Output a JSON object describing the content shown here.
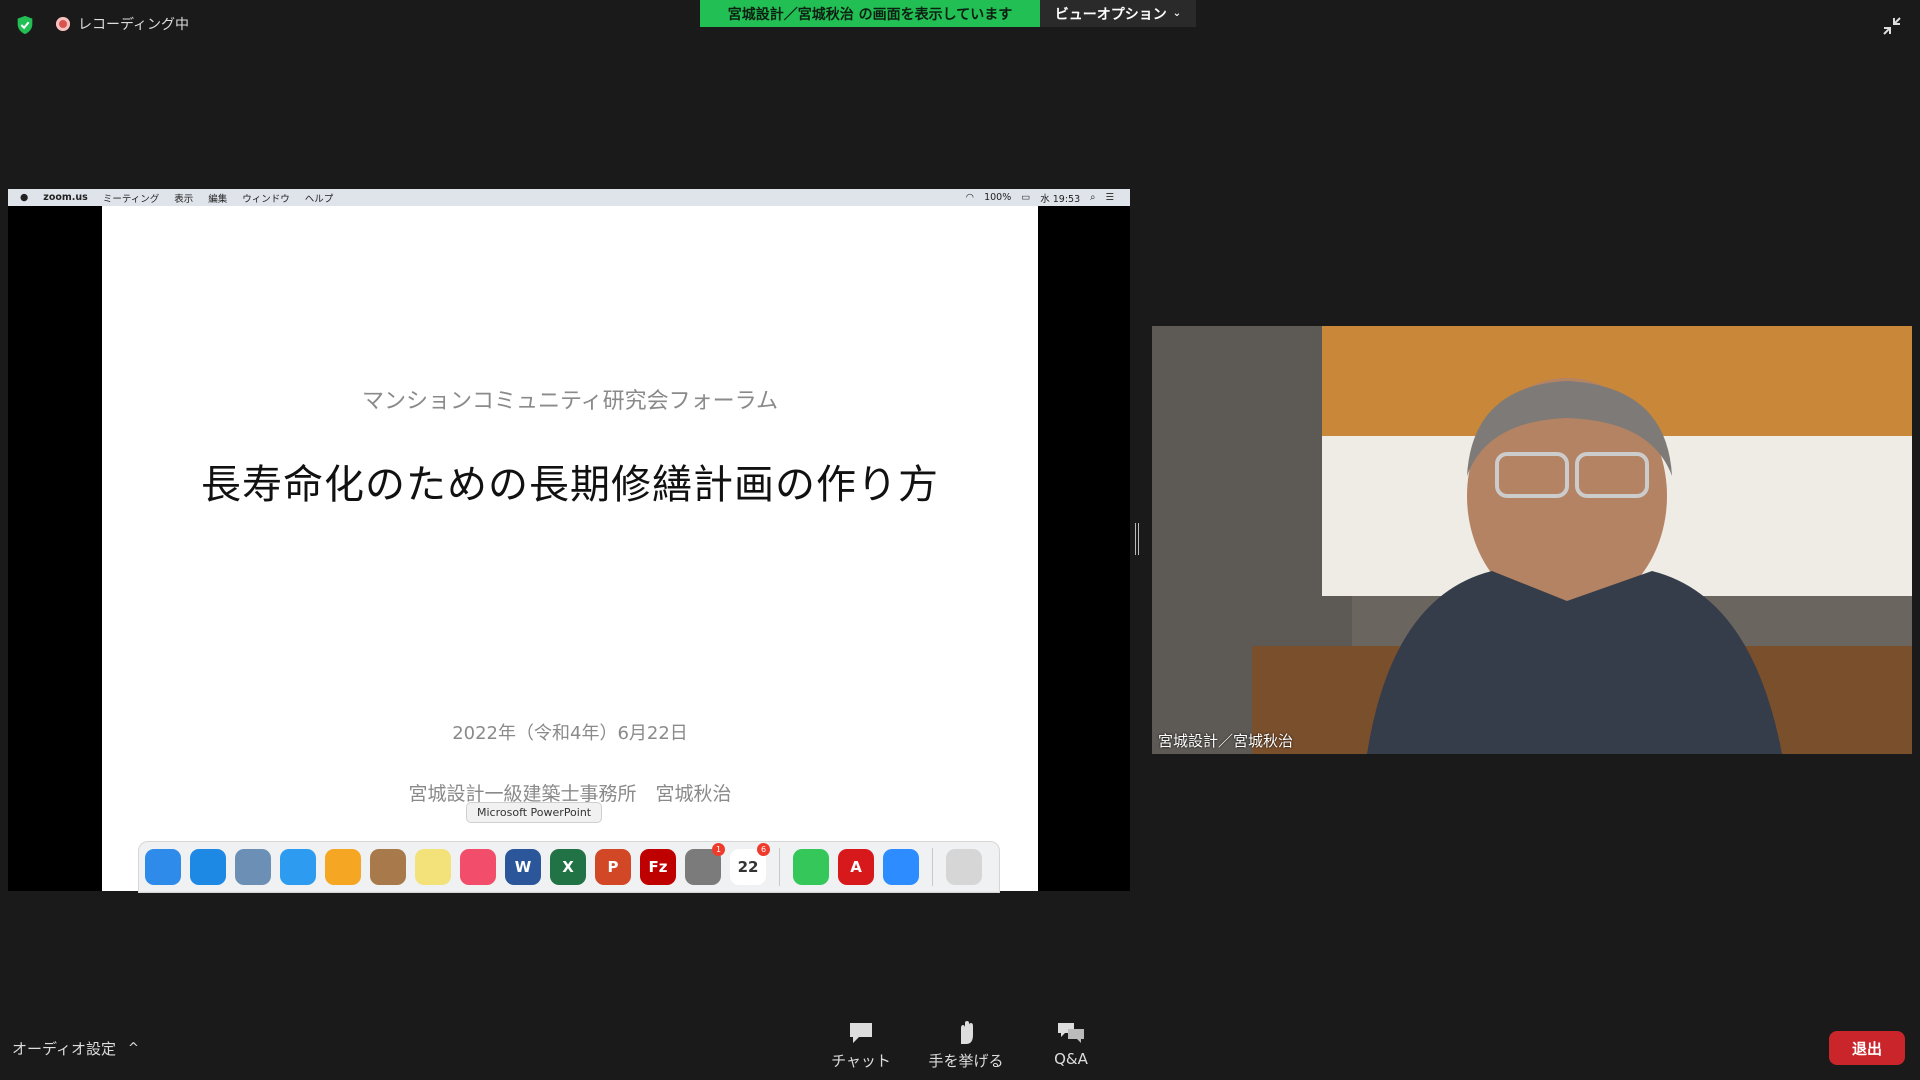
{
  "top_bar": {
    "recording_label": "レコーディング中",
    "share_banner": "宮城設計／宮城秋治 の画面を表示しています",
    "view_options_label": "ビューオプション",
    "accent_green": "#22bf54"
  },
  "mac_menubar": {
    "app": "zoom.us",
    "items": [
      "ミーティング",
      "表示",
      "編集",
      "ウィンドウ",
      "ヘルプ"
    ],
    "battery": "100%",
    "clock": "水 19:53"
  },
  "slide": {
    "subtitle": "マンションコミュニティ研究会フォーラム",
    "title": "長寿命化のための長期修繕計画の作り方",
    "date": "2022年（令和4年）6月22日",
    "author": "宮城設計一級建築士事務所　宮城秋治"
  },
  "dock": {
    "tooltip": "Microsoft PowerPoint",
    "apps": [
      {
        "name": "finder-icon",
        "color": "#2e8bea"
      },
      {
        "name": "safari-icon",
        "color": "#1e88e5"
      },
      {
        "name": "preview-icon",
        "color": "#6c8fb5"
      },
      {
        "name": "messages-icon",
        "color": "#2d9cf0"
      },
      {
        "name": "photos-icon",
        "color": "#f5a623"
      },
      {
        "name": "contacts-icon",
        "color": "#a8794a"
      },
      {
        "name": "notes-icon",
        "color": "#f3e27a"
      },
      {
        "name": "music-icon",
        "color": "#f24d6b"
      },
      {
        "name": "word-icon",
        "color": "#2b579a",
        "glyph": "W"
      },
      {
        "name": "excel-icon",
        "color": "#217346",
        "glyph": "X"
      },
      {
        "name": "powerpoint-icon",
        "color": "#d24726",
        "glyph": "P"
      },
      {
        "name": "filezilla-icon",
        "color": "#bf0000",
        "glyph": "Fz"
      },
      {
        "name": "system-preferences-icon",
        "color": "#7b7b7b",
        "badge": "1"
      },
      {
        "name": "calendar-icon",
        "color": "#ffffff",
        "glyph": "22",
        "badge": "6"
      },
      {
        "name": "facetime-icon",
        "color": "#35c759"
      },
      {
        "name": "acrobat-icon",
        "color": "#d7191c",
        "glyph": "A"
      },
      {
        "name": "zoom-icon",
        "color": "#2d8cff"
      },
      {
        "name": "trash-icon",
        "color": "#d6d6d6"
      }
    ]
  },
  "video": {
    "participant_name": "宮城設計／宮城秋治"
  },
  "bottom_toolbar": {
    "audio_settings": "オーディオ設定",
    "chat": "チャット",
    "raise_hand": "手を挙げる",
    "qa": "Q&A",
    "leave": "退出",
    "leave_color": "#c9252b"
  }
}
